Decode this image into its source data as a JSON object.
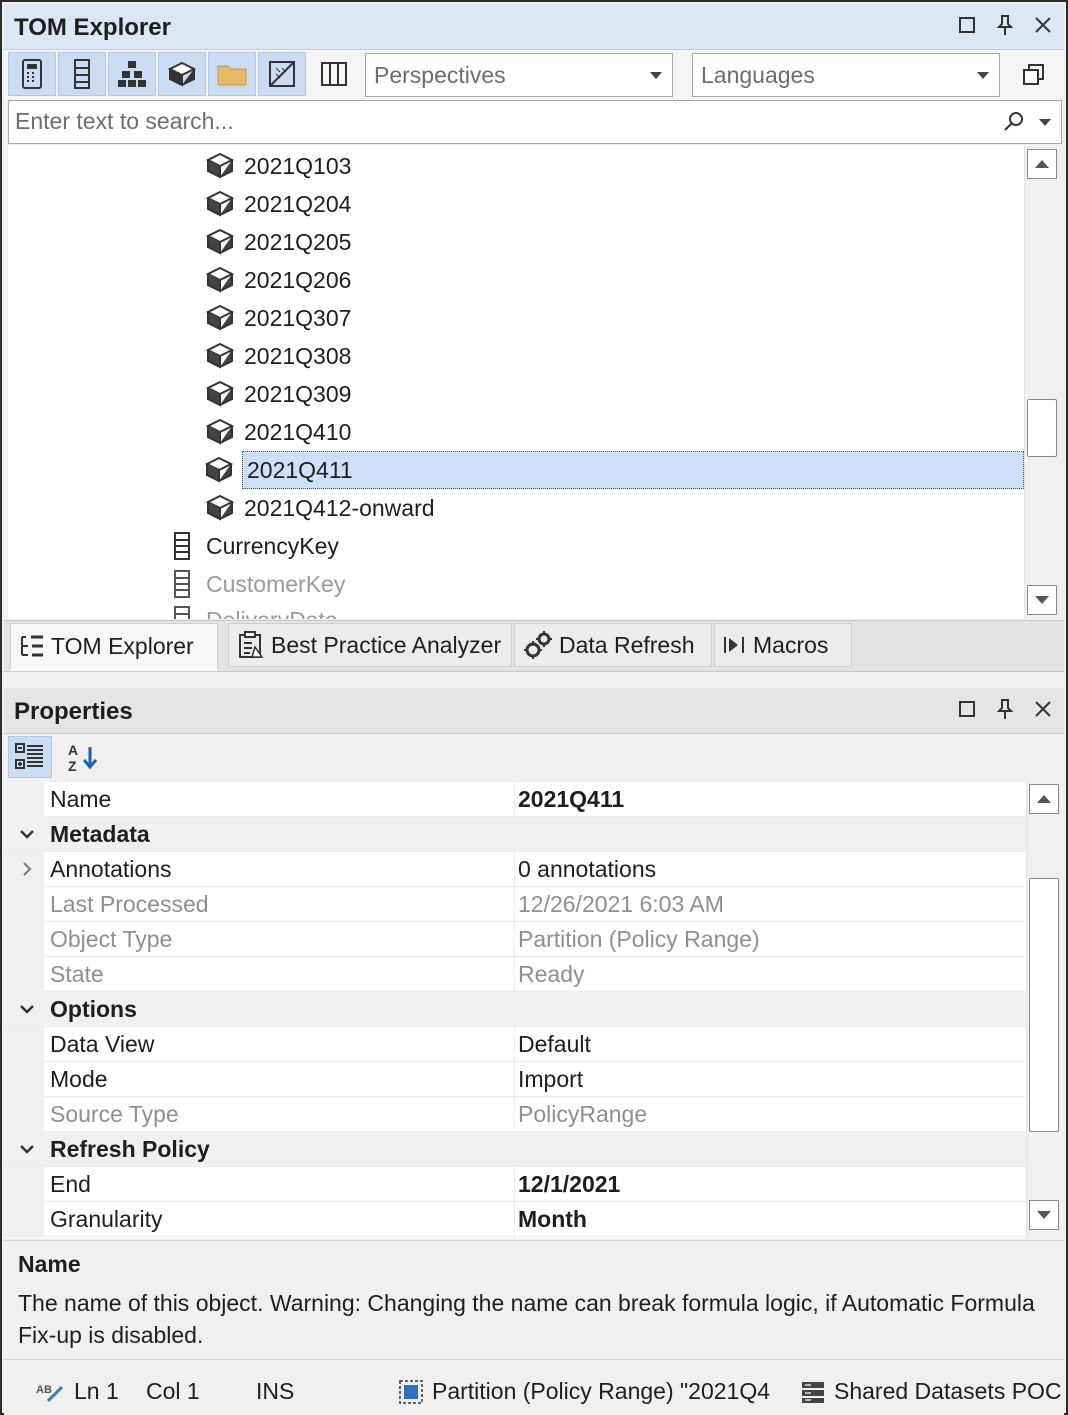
{
  "tom_explorer": {
    "title": "TOM Explorer",
    "toolbar": {
      "perspectives_placeholder": "Perspectives",
      "languages_placeholder": "Languages"
    },
    "search_placeholder": "Enter text to search...",
    "tree_items": [
      {
        "label": "2021Q103",
        "icon": "partition-icon"
      },
      {
        "label": "2021Q204",
        "icon": "partition-icon"
      },
      {
        "label": "2021Q205",
        "icon": "partition-icon"
      },
      {
        "label": "2021Q206",
        "icon": "partition-icon"
      },
      {
        "label": "2021Q307",
        "icon": "partition-icon"
      },
      {
        "label": "2021Q308",
        "icon": "partition-icon"
      },
      {
        "label": "2021Q309",
        "icon": "partition-icon"
      },
      {
        "label": "2021Q410",
        "icon": "partition-icon"
      },
      {
        "label": "2021Q411",
        "icon": "partition-icon",
        "selected": true
      },
      {
        "label": "2021Q412-onward",
        "icon": "partition-icon"
      },
      {
        "label": "CurrencyKey",
        "icon": "column-icon"
      },
      {
        "label": "CustomerKey",
        "icon": "column-icon",
        "hidden": true
      },
      {
        "label": "DeliveryDate",
        "icon": "column-icon",
        "hidden": true
      }
    ],
    "tabs": [
      "TOM Explorer",
      "Best Practice Analyzer",
      "Data Refresh",
      "Macros"
    ]
  },
  "properties": {
    "title": "Properties",
    "name_row": {
      "name": "Name",
      "value": "2021Q411"
    },
    "categories": {
      "metadata": "Metadata",
      "options": "Options",
      "refresh_policy": "Refresh Policy"
    },
    "rows": {
      "annotations": {
        "name": "Annotations",
        "value": "0 annotations"
      },
      "last_processed": {
        "name": "Last Processed",
        "value": "12/26/2021 6:03 AM"
      },
      "object_type": {
        "name": "Object Type",
        "value": "Partition (Policy Range)"
      },
      "state": {
        "name": "State",
        "value": "Ready"
      },
      "data_view": {
        "name": "Data View",
        "value": "Default"
      },
      "mode": {
        "name": "Mode",
        "value": "Import"
      },
      "source_type": {
        "name": "Source Type",
        "value": "PolicyRange"
      },
      "end": {
        "name": "End",
        "value": "12/1/2021"
      },
      "granularity": {
        "name": "Granularity",
        "value": "Month"
      }
    },
    "description": {
      "title": "Name",
      "text": "The name of this object. Warning: Changing the name can break formula logic, if Automatic Formula Fix-up is disabled."
    }
  },
  "status_bar": {
    "line": "Ln 1",
    "col": "Col 1",
    "mode": "INS",
    "selection": "Partition (Policy Range) \"2021Q4",
    "model": "Shared Datasets POC"
  }
}
